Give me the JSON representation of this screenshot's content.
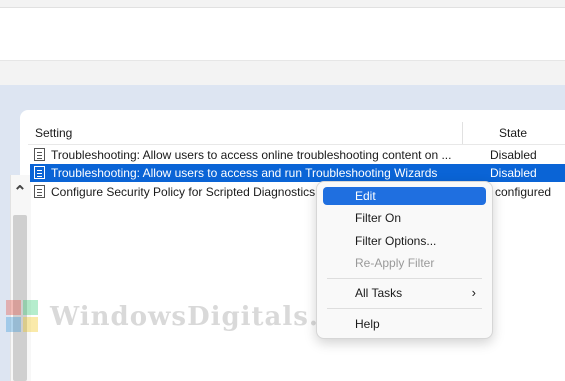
{
  "table": {
    "columns": {
      "setting": "Setting",
      "state": "State"
    },
    "rows": [
      {
        "name": "Troubleshooting: Allow users to access online troubleshooting content on ...",
        "state": "Disabled"
      },
      {
        "name": "Troubleshooting: Allow users to access and run Troubleshooting Wizards",
        "state": "Disabled"
      },
      {
        "name": "Configure Security Policy for Scripted Diagnostics",
        "state": "configured"
      }
    ]
  },
  "context_menu": {
    "edit": "Edit",
    "filter_on": "Filter On",
    "filter_options": "Filter Options...",
    "reapply_filter": "Re-Apply Filter",
    "all_tasks": "All Tasks",
    "help": "Help"
  },
  "watermark": {
    "text": "WindowsDigitals.com"
  },
  "colors": {
    "selection": "#0a64d6",
    "menu_highlight": "#1f6fe0",
    "pane_background": "#dde5f2"
  }
}
